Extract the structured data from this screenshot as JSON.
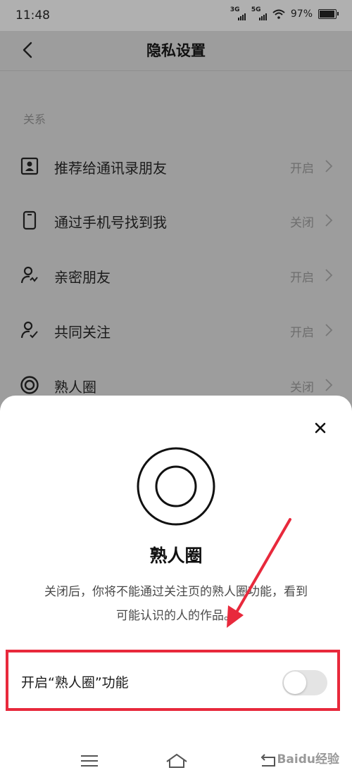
{
  "status_bar": {
    "time": "11:48",
    "net1": "3G",
    "net2": "5G",
    "battery": "97%"
  },
  "header": {
    "title": "隐私设置",
    "back_icon": "chevron-left-icon"
  },
  "section": {
    "title": "关系"
  },
  "settings": [
    {
      "label": "推荐给通讯录朋友",
      "value": "开启",
      "icon": "contact-card-icon"
    },
    {
      "label": "通过手机号找到我",
      "value": "关闭",
      "icon": "phone-icon"
    },
    {
      "label": "亲密朋友",
      "value": "开启",
      "icon": "person-heart-icon"
    },
    {
      "label": "共同关注",
      "value": "开启",
      "icon": "person-check-icon"
    },
    {
      "label": "熟人圈",
      "value": "关闭",
      "icon": "target-circle-icon"
    }
  ],
  "sheet": {
    "title": "熟人圈",
    "description": "关闭后，你将不能通过关注页的熟人圈功能，看到可能认识的人的作品。",
    "toggle_label": "开启“熟人圈”功能",
    "toggle_on": false,
    "highlight_color": "#e8293c"
  },
  "watermark": "Baidu经验",
  "colors": {
    "overlay": "#9d9d9d",
    "sheet_bg": "#ffffff",
    "annotation": "#e8293c"
  }
}
